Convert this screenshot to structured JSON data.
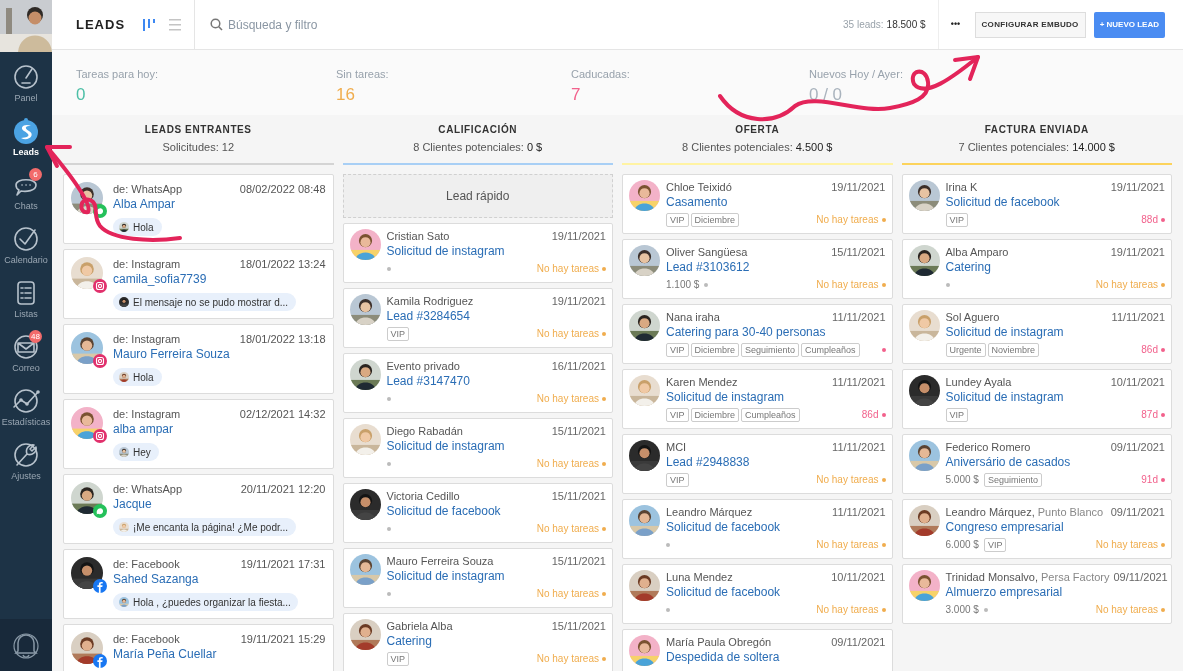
{
  "sidebar": {
    "items": [
      {
        "kind": "gauge",
        "label": "Panel",
        "selected": false
      },
      {
        "kind": "logo",
        "label": "Leads",
        "selected": true
      },
      {
        "kind": "chat",
        "label": "Chats",
        "selected": false,
        "badge": "6"
      },
      {
        "kind": "check",
        "label": "Calendario",
        "selected": false
      },
      {
        "kind": "list",
        "label": "Listas",
        "selected": false
      },
      {
        "kind": "mail",
        "label": "Correo",
        "selected": false,
        "badge": "48"
      },
      {
        "kind": "stats",
        "label": "Estadísticas",
        "selected": false
      },
      {
        "kind": "wrench",
        "label": "Ajustes",
        "selected": false
      }
    ]
  },
  "header": {
    "title": "LEADS",
    "views": [
      {
        "kind": "pipeline",
        "selected": true
      },
      {
        "kind": "list",
        "selected": false
      }
    ],
    "search": {
      "placeholder": "Búsqueda y filtro"
    },
    "total_label": "35 leads:",
    "total_amount": "18.500 $",
    "more_button": "•••",
    "config_button": "CONFIGURAR EMBUDO",
    "new_button": "+ NUEVO LEAD"
  },
  "stats": [
    {
      "label": "Tareas para hoy:",
      "value": "0",
      "color": "#4cbfa6"
    },
    {
      "label": "Sin tareas:",
      "value": "16",
      "color": "#f0ad4e"
    },
    {
      "label": "Caducadas:",
      "value": "7",
      "color": "#f2618c"
    },
    {
      "label": "Nuevos Hoy / Ayer:",
      "value": "0 / 0",
      "color": "#a9b3bd"
    }
  ],
  "columns": [
    {
      "title": "LEADS ENTRANTES",
      "summary": "Solicitudes: 12",
      "color": "#d4d4d4",
      "cards": [
        {
          "kind": "chat",
          "source": "de: WhatsApp",
          "time": "08/02/2022 08:48",
          "name": "Alba Ampar",
          "message": "Hola",
          "badge": {
            "kind": "whatsapp"
          }
        },
        {
          "kind": "chat",
          "source": "de: Instagram",
          "time": "18/01/2022 13:24",
          "name": "camila_sofia7739",
          "message": "El mensaje no se pudo mostrar d...",
          "badge": {
            "kind": "instagram"
          }
        },
        {
          "kind": "chat",
          "source": "de: Instagram",
          "time": "18/01/2022 13:18",
          "name": "Mauro Ferreira Souza",
          "message": "Hola",
          "badge": {
            "kind": "instagram"
          }
        },
        {
          "kind": "chat",
          "source": "de: Instagram",
          "time": "02/12/2021 14:32",
          "name": "alba ampar",
          "message": "Hey",
          "badge": {
            "kind": "instagram"
          }
        },
        {
          "kind": "chat",
          "source": "de: WhatsApp",
          "time": "20/11/2021 12:20",
          "name": "Jacque",
          "message": "¡Me encanta la página! ¿Me podr...",
          "badge": {
            "kind": "whatsapp"
          }
        },
        {
          "kind": "chat",
          "source": "de: Facebook",
          "time": "19/11/2021 17:31",
          "name": "Sahed Sazanga",
          "message": "Hola , ¿puedes organizar la fiesta...",
          "badge": {
            "kind": "facebook"
          }
        },
        {
          "kind": "chat",
          "source": "de: Facebook",
          "time": "19/11/2021 15:29",
          "name": "María Peña Cuellar",
          "badge": {
            "kind": "facebook"
          }
        }
      ]
    },
    {
      "title": "CALIFICACIÓN",
      "summary": "8 Clientes potenciales:",
      "amount": "0 $",
      "color": "#a8cff5",
      "quick_add": "Lead rápido",
      "cards": [
        {
          "kind": "deal",
          "contact": "Cristian Sato",
          "date": "19/11/2021",
          "title": "Solicitud de instagram",
          "task": {
            "text": "No hay tareas",
            "overdue": false
          }
        },
        {
          "kind": "deal",
          "contact": "Kamila Rodriguez",
          "date": "19/11/2021",
          "title": "Lead #3284654",
          "tags": [
            "VIP"
          ],
          "task": {
            "text": "No hay tareas",
            "overdue": false
          }
        },
        {
          "kind": "deal",
          "contact": "Evento privado",
          "date": "16/11/2021",
          "title": "Lead #3147470",
          "task": {
            "text": "No hay tareas",
            "overdue": false
          }
        },
        {
          "kind": "deal",
          "contact": "Diego Rabadán",
          "date": "15/11/2021",
          "title": "Solicitud de instagram",
          "task": {
            "text": "No hay tareas",
            "overdue": false
          }
        },
        {
          "kind": "deal",
          "contact": "Victoria Cedillo",
          "date": "15/11/2021",
          "title": "Solicitud de facebook",
          "task": {
            "text": "No hay tareas",
            "overdue": false
          }
        },
        {
          "kind": "deal",
          "contact": "Mauro Ferreira Souza",
          "date": "15/11/2021",
          "title": "Solicitud de instagram",
          "task": {
            "text": "No hay tareas",
            "overdue": false
          }
        },
        {
          "kind": "deal",
          "contact": "Gabriela Alba",
          "date": "15/11/2021",
          "title": "Catering",
          "tags": [
            "VIP"
          ],
          "task": {
            "text": "No hay tareas",
            "overdue": false
          }
        }
      ]
    },
    {
      "title": "OFERTA",
      "summary": "8 Clientes potenciales:",
      "amount": "4.500 $",
      "color": "#fff3a3",
      "cards": [
        {
          "kind": "deal",
          "contact": "Chloe Teixidó",
          "date": "19/11/2021",
          "title": "Casamento",
          "tags": [
            "VIP",
            "Diciembre"
          ],
          "task": {
            "text": "No hay tareas",
            "overdue": false
          }
        },
        {
          "kind": "deal",
          "contact": "Oliver Sangüesa",
          "date": "15/11/2021",
          "title": "Lead #3103612",
          "amount": "1.100 $",
          "task": {
            "text": "No hay tareas",
            "overdue": false
          }
        },
        {
          "kind": "deal",
          "contact": "Nana iraha",
          "date": "11/11/2021",
          "title": "Catering para 30-40 personas",
          "tags": [
            "VIP",
            "Diciembre",
            "Seguimiento",
            "Cumpleaños"
          ],
          "task": {
            "overdue": true
          }
        },
        {
          "kind": "deal",
          "contact": "Karen Mendez",
          "date": "11/11/2021",
          "title": "Solicitud de instagram",
          "tags": [
            "VIP",
            "Diciembre",
            "Cumpleaños"
          ],
          "task": {
            "text": "86d",
            "overdue": true
          }
        },
        {
          "kind": "deal",
          "contact": "MCI",
          "date": "11/11/2021",
          "title": "Lead #2948838",
          "tags": [
            "VIP"
          ],
          "task": {
            "text": "No hay tareas",
            "overdue": false
          }
        },
        {
          "kind": "deal",
          "contact": "Leandro Márquez",
          "date": "11/11/2021",
          "title": "Solicitud de facebook",
          "task": {
            "text": "No hay tareas",
            "overdue": false
          }
        },
        {
          "kind": "deal",
          "contact": "Luna Mendez",
          "date": "10/11/2021",
          "title": "Solicitud de facebook",
          "task": {
            "text": "No hay tareas",
            "overdue": false
          }
        },
        {
          "kind": "deal",
          "contact": "María Paula Obregón",
          "date": "09/11/2021",
          "title": "Despedida de soltera"
        }
      ]
    },
    {
      "title": "FACTURA ENVIADA",
      "summary": "7 Clientes potenciales:",
      "amount": "14.000 $",
      "color": "#fcd35c",
      "cards": [
        {
          "kind": "deal",
          "contact": "Irina K",
          "date": "19/11/2021",
          "title": "Solicitud de facebook",
          "tags": [
            "VIP"
          ],
          "task": {
            "text": "88d",
            "overdue": true
          }
        },
        {
          "kind": "deal",
          "contact": "Alba Amparo",
          "date": "19/11/2021",
          "title": "Catering",
          "task": {
            "text": "No hay tareas",
            "overdue": false
          }
        },
        {
          "kind": "deal",
          "contact": "Sol Aguero",
          "date": "11/11/2021",
          "title": "Solicitud de instagram",
          "tags": [
            "Urgente",
            "Noviembre"
          ],
          "task": {
            "text": "86d",
            "overdue": true
          }
        },
        {
          "kind": "deal",
          "contact": "Lundey Ayala",
          "date": "10/11/2021",
          "title": "Solicitud de instagram",
          "tags": [
            "VIP"
          ],
          "task": {
            "text": "87d",
            "overdue": true
          }
        },
        {
          "kind": "deal",
          "contact": "Federico Romero",
          "date": "09/11/2021",
          "title": "Aniversário de casados",
          "amount": "5.000 $",
          "tags": [
            "Seguimiento"
          ],
          "task": {
            "text": "91d",
            "overdue": true
          }
        },
        {
          "kind": "deal",
          "contact": "Leandro Márquez,",
          "company": "Punto Blanco",
          "date": "09/11/2021",
          "title": "Congreso empresarial",
          "amount": "6.000 $",
          "tags": [
            "VIP"
          ],
          "task": {
            "text": "No hay tareas",
            "overdue": false
          }
        },
        {
          "kind": "deal",
          "contact": "Trinidad Monsalvo,",
          "company": "Persa Factory",
          "date": "09/11/2021",
          "title": "Almuerzo empresarial",
          "amount": "3.000 $",
          "task": {
            "text": "No hay tareas",
            "overdue": false
          }
        }
      ]
    }
  ]
}
